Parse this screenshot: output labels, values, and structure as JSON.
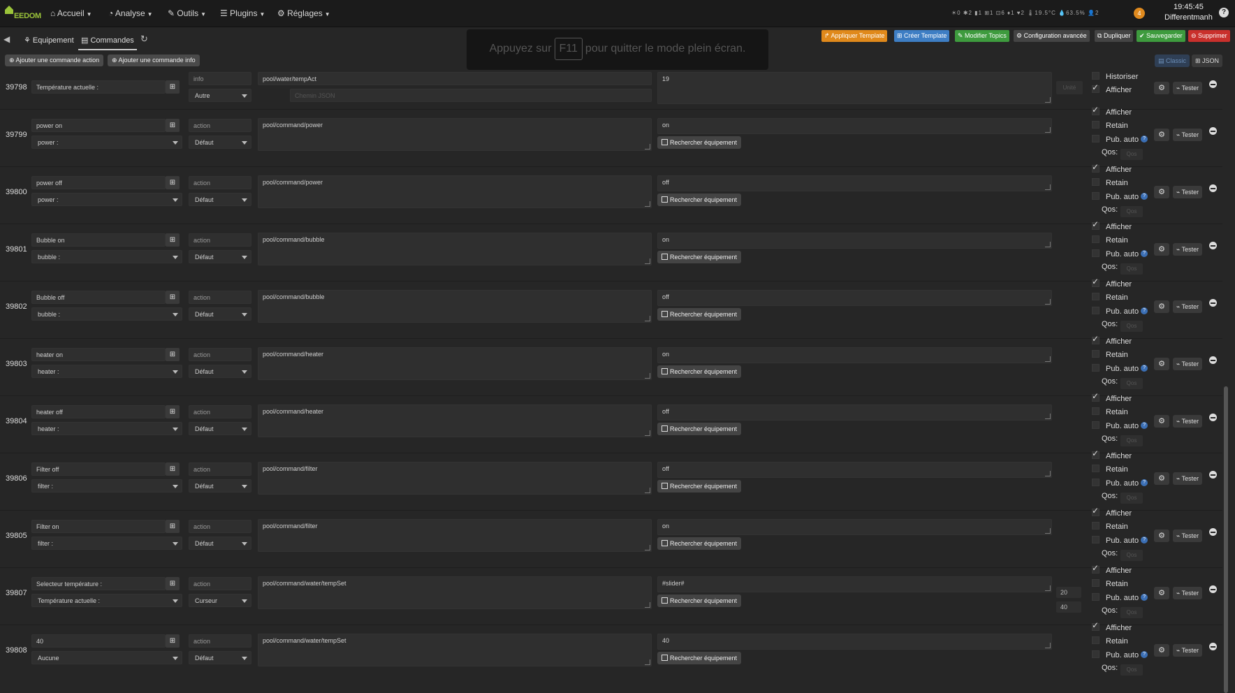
{
  "topbar": {
    "logo_text": "EEDOM",
    "menus": [
      {
        "label": "Accueil",
        "icon": "home-icon"
      },
      {
        "label": "Analyse",
        "icon": "analyse-icon"
      },
      {
        "label": "Outils",
        "icon": "wrench-icon"
      },
      {
        "label": "Plugins",
        "icon": "list-icon"
      },
      {
        "label": "Réglages",
        "icon": "gear-icon"
      }
    ],
    "status_icons": "☀0 ✱2 ▮1 ⊞1 ⊡6 ♦1 ♥2 🌡19.5°C 💧63.5% 👤2",
    "notification_count": "4",
    "clock": "19:45:45",
    "user": "Differentmanh",
    "help": "?"
  },
  "tabs": {
    "equipment": "Equipement",
    "commands": "Commandes"
  },
  "actions": {
    "apply_template": "Appliquer Template",
    "create_template": "Créer Template",
    "edit_topics": "Modifier Topics",
    "advanced_config": "Configuration avancée",
    "duplicate": "Dupliquer",
    "save": "Sauvegarder",
    "delete": "Supprimer",
    "colors": {
      "orange": "#e0891b",
      "blue": "#3e7ec4",
      "green": "#3e9b3e",
      "red": "#c9302c"
    }
  },
  "fullscreen_banner": {
    "before": "Appuyez sur",
    "key": "F11",
    "after": "pour quitter le mode plein écran."
  },
  "toolbar": {
    "add_action": "Ajouter une commande action",
    "add_info": "Ajouter une commande info",
    "classic": "Classic",
    "json": "JSON"
  },
  "labels": {
    "historiser": "Historiser",
    "afficher": "Afficher",
    "retain": "Retain",
    "pub_auto": "Pub. auto",
    "qos": "Qos:",
    "qos_placeholder": "Qos",
    "tester": "Tester",
    "search_equipment": "Rechercher équipement",
    "unit_placeholder": "Unité",
    "json_path_placeholder": "Chemin JSON"
  },
  "info_command": {
    "id": "39798",
    "name": "Température actuelle :",
    "type": "info",
    "subtype": "Autre",
    "topic": "pool/water/tempAct",
    "value": "19",
    "historiser": false,
    "afficher": true
  },
  "commands": [
    {
      "id": "39799",
      "name": "power on",
      "link": "power :",
      "type": "action",
      "subtype": "Défaut",
      "topic": "pool/command/power",
      "payload": "on",
      "afficher": true,
      "retain": false,
      "pub_auto": false
    },
    {
      "id": "39800",
      "name": "power off",
      "link": "power :",
      "type": "action",
      "subtype": "Défaut",
      "topic": "pool/command/power",
      "payload": "off",
      "afficher": true,
      "retain": false,
      "pub_auto": false
    },
    {
      "id": "39801",
      "name": "Bubble on",
      "link": "bubble :",
      "type": "action",
      "subtype": "Défaut",
      "topic": "pool/command/bubble",
      "payload": "on",
      "afficher": true,
      "retain": false,
      "pub_auto": false
    },
    {
      "id": "39802",
      "name": "Bubble off",
      "link": "bubble :",
      "type": "action",
      "subtype": "Défaut",
      "topic": "pool/command/bubble",
      "payload": "off",
      "afficher": true,
      "retain": false,
      "pub_auto": false
    },
    {
      "id": "39803",
      "name": "heater on",
      "link": "heater :",
      "type": "action",
      "subtype": "Défaut",
      "topic": "pool/command/heater",
      "payload": "on",
      "afficher": true,
      "retain": false,
      "pub_auto": false
    },
    {
      "id": "39804",
      "name": "heater off",
      "link": "heater :",
      "type": "action",
      "subtype": "Défaut",
      "topic": "pool/command/heater",
      "payload": "off",
      "afficher": true,
      "retain": false,
      "pub_auto": false
    },
    {
      "id": "39806",
      "name": "Filter off",
      "link": "filter :",
      "type": "action",
      "subtype": "Défaut",
      "topic": "pool/command/filter",
      "payload": "off",
      "afficher": true,
      "retain": false,
      "pub_auto": false
    },
    {
      "id": "39805",
      "name": "Filter on",
      "link": "filter :",
      "type": "action",
      "subtype": "Défaut",
      "topic": "pool/command/filter",
      "payload": "on",
      "afficher": true,
      "retain": false,
      "pub_auto": false
    },
    {
      "id": "39807",
      "name": "Selecteur température :",
      "link": "Température actuelle :",
      "type": "action",
      "subtype": "Curseur",
      "topic": "pool/command/water/tempSet",
      "payload": "#slider#",
      "min": "20",
      "max": "40",
      "afficher": true,
      "retain": false,
      "pub_auto": false
    },
    {
      "id": "39808",
      "name": "40",
      "link": "Aucune",
      "type": "action",
      "subtype": "Défaut",
      "topic": "pool/command/water/tempSet",
      "payload": "40",
      "afficher": true,
      "retain": false,
      "pub_auto": false
    }
  ]
}
